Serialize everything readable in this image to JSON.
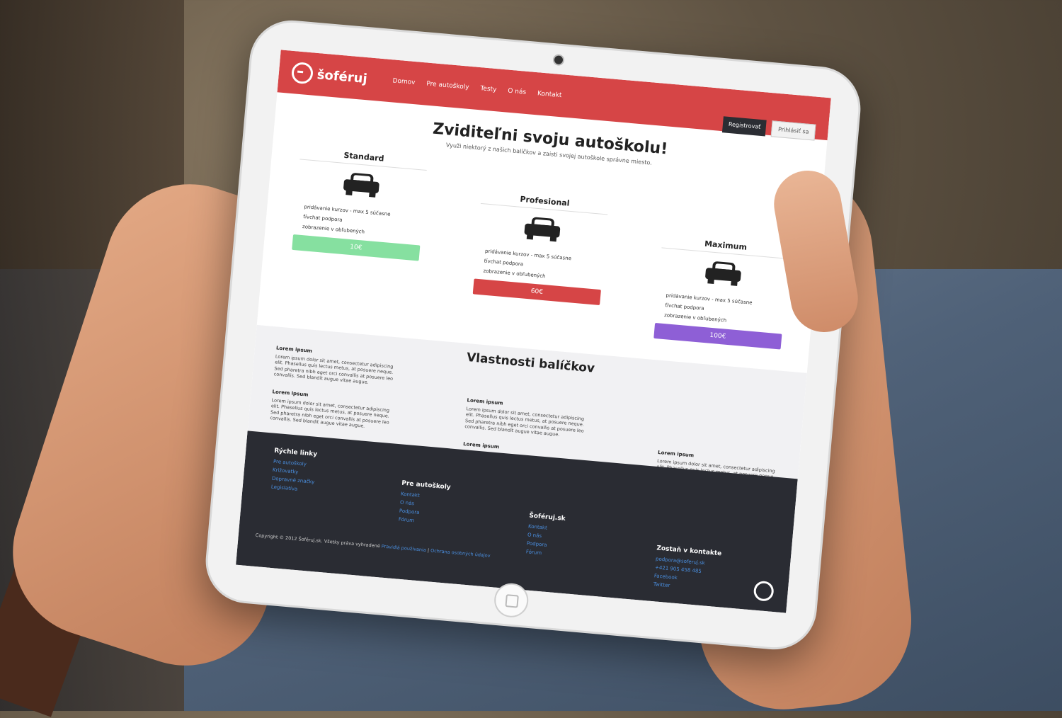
{
  "brand": {
    "name": "šoféruj",
    "accent": "#d64546",
    "dark": "#2a2c33"
  },
  "nav": [
    "Domov",
    "Pre autoškoly",
    "Testy",
    "O nás",
    "Kontakt"
  ],
  "auth": {
    "register": "Registrovať",
    "login": "Prihlásiť sa"
  },
  "hero": {
    "title": "Zviditeľni svoju autoškolu!",
    "subtitle": "Využi niektorý z našich balíčkov a zaisti svojej autoškole správne miesto."
  },
  "plans": [
    {
      "name": "Standard",
      "features": [
        "pridávanie kurzov - max 5 súčasne",
        "ťívchat podpora",
        "zobrazenie v obľubených"
      ],
      "price": "10€",
      "color": "#86e0a0"
    },
    {
      "name": "Profesional",
      "features": [
        "pridávanie kurzov - max 5 súčasne",
        "ťívchat podpora",
        "zobrazenie v obľubených"
      ],
      "price": "60€",
      "color": "#d64546"
    },
    {
      "name": "Maximum",
      "features": [
        "pridávanie kurzov - max 5 súčasne",
        "ťívchat podpora",
        "zobrazenie v obľubených"
      ],
      "price": "100€",
      "color": "#8e5fd6"
    }
  ],
  "features_section": {
    "title": "Vlastnosti balíčkov",
    "item_title": "Lorem ipsum",
    "item_text": "Lorem ipsum dolor sit amet, consectetur adipiscing elit. Phasellus quis lectus metus, at posuere neque. Sed pharetra nibh eget orci convallis at posuere leo convallis. Sed blandit augue vitae augue."
  },
  "footer": {
    "col1": {
      "title": "Rýchle linky",
      "links": [
        "Pre autoškoly",
        "Križovatky",
        "Dopravné značky",
        "Legislatíva"
      ]
    },
    "col2": {
      "title": "Pre autoškoly",
      "links": [
        "Kontakt",
        "O nás",
        "Podpora",
        "Fórum"
      ]
    },
    "col3": {
      "title": "Šoféruj.sk",
      "links": [
        "Kontakt",
        "O nás",
        "Podpora",
        "Fórum"
      ]
    },
    "col4": {
      "title": "Zostaň v kontakte",
      "links": [
        "podpora@soferuj.sk",
        "+421 905 458 485",
        "Facebook",
        "Twitter"
      ]
    },
    "copyright": "Copyright © 2012 Šoféruj.sk. Všetky práva vyhradené",
    "terms": "Pravidlá používania",
    "privacy": "Ochrana osobných údajov"
  }
}
